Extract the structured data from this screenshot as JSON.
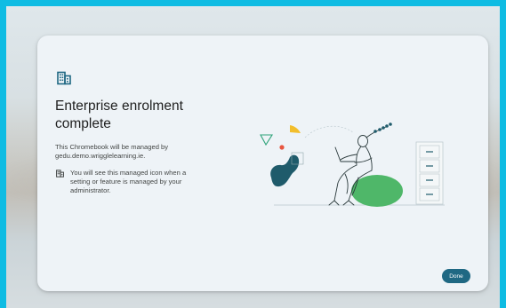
{
  "dialog": {
    "title_line1": "Enterprise enrolment",
    "title_line2": "complete",
    "description_line1": "This Chromebook will be managed by",
    "description_line2": "gedu.demo.wrigglelearning.ie.",
    "notice_line1": "You will see this managed icon when a",
    "notice_line2": "setting or feature is managed by your",
    "notice_line3": "administrator.",
    "done_label": "Done"
  },
  "icons": {
    "header_icon": "building-icon",
    "notice_icon": "managed-building-icon"
  },
  "colors": {
    "screen_border": "#0fbce3",
    "dialog_background": "#eef3f7",
    "primary_button": "#1f6883",
    "header_icon": "#1f6883",
    "illustration_green": "#4fb769",
    "illustration_teal": "#1f5b6b",
    "illustration_yellow": "#f2be2c",
    "illustration_red": "#e8553f",
    "illustration_line": "#2b3a3c"
  }
}
